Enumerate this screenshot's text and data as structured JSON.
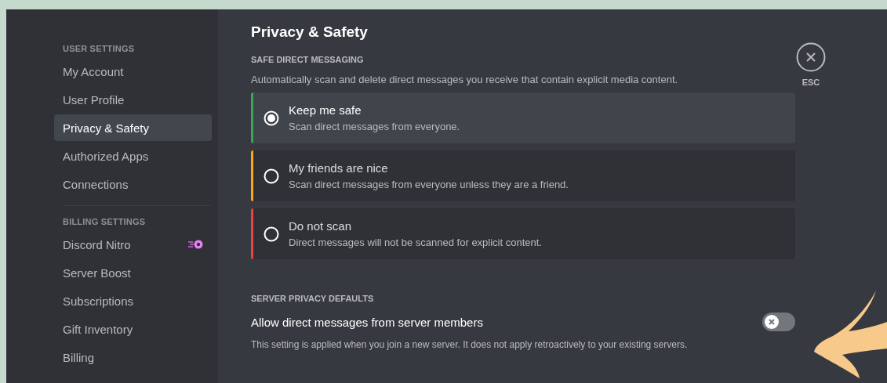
{
  "sidebar": {
    "sections": [
      {
        "heading": "USER SETTINGS",
        "items": [
          {
            "label": "My Account",
            "selected": false
          },
          {
            "label": "User Profile",
            "selected": false
          },
          {
            "label": "Privacy & Safety",
            "selected": true
          },
          {
            "label": "Authorized Apps",
            "selected": false
          },
          {
            "label": "Connections",
            "selected": false
          }
        ]
      },
      {
        "heading": "BILLING SETTINGS",
        "items": [
          {
            "label": "Discord Nitro",
            "selected": false,
            "badge": true
          },
          {
            "label": "Server Boost",
            "selected": false
          },
          {
            "label": "Subscriptions",
            "selected": false
          },
          {
            "label": "Gift Inventory",
            "selected": false
          },
          {
            "label": "Billing",
            "selected": false
          }
        ]
      }
    ]
  },
  "main": {
    "title": "Privacy & Safety",
    "safe_dm": {
      "heading": "SAFE DIRECT MESSAGING",
      "description": "Automatically scan and delete direct messages you receive that contain explicit media content.",
      "options": [
        {
          "label": "Keep me safe",
          "description": "Scan direct messages from everyone.",
          "selected": true,
          "color": "#3ba55c"
        },
        {
          "label": "My friends are nice",
          "description": "Scan direct messages from everyone unless they are a friend.",
          "selected": false,
          "color": "#faa81a"
        },
        {
          "label": "Do not scan",
          "description": "Direct messages will not be scanned for explicit content.",
          "selected": false,
          "color": "#ed4245"
        }
      ]
    },
    "server_privacy": {
      "heading": "SERVER PRIVACY DEFAULTS",
      "label": "Allow direct messages from server members",
      "on": false,
      "description": "This setting is applied when you join a new server. It does not apply retroactively to your existing servers."
    }
  },
  "close": {
    "label": "ESC"
  }
}
